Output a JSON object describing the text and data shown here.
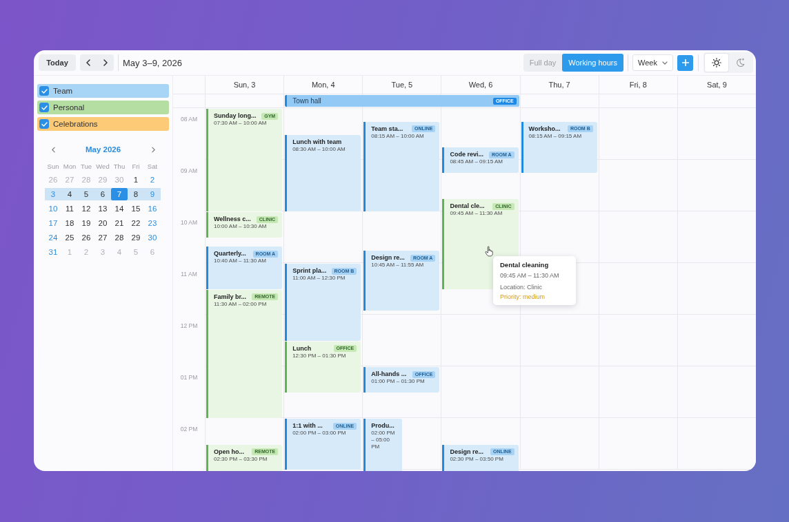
{
  "toolbar": {
    "today_button": "Today",
    "date_range": "May 3–9, 2026",
    "range_options": [
      {
        "label": "Full day",
        "selected": false
      },
      {
        "label": "Working hours",
        "selected": true
      }
    ],
    "view_select": {
      "value": "Week"
    },
    "theme_options": [
      {
        "kind": "light",
        "selected": true
      },
      {
        "kind": "dark",
        "selected": false
      }
    ]
  },
  "sidebar": {
    "categories": [
      {
        "label": "Team",
        "checked": true,
        "color": "#a8d5f6"
      },
      {
        "label": "Personal",
        "checked": true,
        "color": "#b4dea2"
      },
      {
        "label": "Celebrations",
        "checked": true,
        "color": "#fdcb78"
      }
    ],
    "mini_calendar": {
      "title": "May 2026",
      "weekdays": [
        "Sun",
        "Mon",
        "Tue",
        "Wed",
        "Thu",
        "Fri",
        "Sat"
      ],
      "weeks": [
        {
          "selected": false,
          "days": [
            {
              "label": "26",
              "outside": true,
              "selected": false
            },
            {
              "label": "27",
              "outside": true,
              "selected": false
            },
            {
              "label": "28",
              "outside": true,
              "selected": false
            },
            {
              "label": "29",
              "outside": true,
              "selected": false
            },
            {
              "label": "30",
              "outside": true,
              "selected": false
            },
            {
              "label": "1",
              "outside": false,
              "selected": false
            },
            {
              "label": "2",
              "outside": false,
              "selected": false
            }
          ]
        },
        {
          "selected": true,
          "days": [
            {
              "label": "3",
              "outside": false,
              "selected": false
            },
            {
              "label": "4",
              "outside": false,
              "selected": false
            },
            {
              "label": "5",
              "outside": false,
              "selected": false
            },
            {
              "label": "6",
              "outside": false,
              "selected": false
            },
            {
              "label": "7",
              "outside": false,
              "selected": true
            },
            {
              "label": "8",
              "outside": false,
              "selected": false
            },
            {
              "label": "9",
              "outside": false,
              "selected": false
            }
          ]
        },
        {
          "selected": false,
          "days": [
            {
              "label": "10",
              "outside": false,
              "selected": false
            },
            {
              "label": "11",
              "outside": false,
              "selected": false
            },
            {
              "label": "12",
              "outside": false,
              "selected": false
            },
            {
              "label": "13",
              "outside": false,
              "selected": false
            },
            {
              "label": "14",
              "outside": false,
              "selected": false
            },
            {
              "label": "15",
              "outside": false,
              "selected": false
            },
            {
              "label": "16",
              "outside": false,
              "selected": false
            }
          ]
        },
        {
          "selected": false,
          "days": [
            {
              "label": "17",
              "outside": false,
              "selected": false
            },
            {
              "label": "18",
              "outside": false,
              "selected": false
            },
            {
              "label": "19",
              "outside": false,
              "selected": false
            },
            {
              "label": "20",
              "outside": false,
              "selected": false
            },
            {
              "label": "21",
              "outside": false,
              "selected": false
            },
            {
              "label": "22",
              "outside": false,
              "selected": false
            },
            {
              "label": "23",
              "outside": false,
              "selected": false
            }
          ]
        },
        {
          "selected": false,
          "days": [
            {
              "label": "24",
              "outside": false,
              "selected": false
            },
            {
              "label": "25",
              "outside": false,
              "selected": false
            },
            {
              "label": "26",
              "outside": false,
              "selected": false
            },
            {
              "label": "27",
              "outside": false,
              "selected": false
            },
            {
              "label": "28",
              "outside": false,
              "selected": false
            },
            {
              "label": "29",
              "outside": false,
              "selected": false
            },
            {
              "label": "30",
              "outside": false,
              "selected": false
            }
          ]
        },
        {
          "selected": false,
          "days": [
            {
              "label": "31",
              "outside": false,
              "selected": false
            },
            {
              "label": "1",
              "outside": true,
              "selected": false
            },
            {
              "label": "2",
              "outside": true,
              "selected": false
            },
            {
              "label": "3",
              "outside": true,
              "selected": false
            },
            {
              "label": "4",
              "outside": true,
              "selected": false
            },
            {
              "label": "5",
              "outside": true,
              "selected": false
            },
            {
              "label": "6",
              "outside": true,
              "selected": false
            }
          ]
        }
      ]
    }
  },
  "calendar": {
    "all_day_events": [
      {
        "title": "Town hall",
        "badge": "OFFICE",
        "kind": "team"
      }
    ],
    "time_labels": [
      "08 AM",
      "09 AM",
      "10 AM",
      "11 AM",
      "12 PM",
      "01 PM",
      "02 PM"
    ],
    "days": [
      {
        "header": "Sun, 3",
        "events": [
          {
            "title": "Sunday long...",
            "badge": "GYM",
            "time": "07:30 AM – 10:00 AM",
            "kind": "personal",
            "overlapped": false
          },
          {
            "title": "Wellness c...",
            "badge": "CLINIC",
            "time": "10:00 AM – 10:30 AM",
            "kind": "personal",
            "overlapped": false
          },
          {
            "title": "Quarterly...",
            "badge": "ROOM A",
            "time": "10:40 AM – 11:30 AM",
            "kind": "team",
            "overlapped": false
          },
          {
            "title": "Family br...",
            "badge": "REMOTE",
            "time": "11:30 AM – 02:00 PM",
            "kind": "personal",
            "overlapped": false
          },
          {
            "title": "Open ho...",
            "badge": "REMOTE",
            "time": "02:30 PM – 03:30 PM",
            "kind": "personal",
            "overlapped": false
          }
        ]
      },
      {
        "header": "Mon, 4",
        "events": [
          {
            "title": "Lunch with team",
            "time": "08:30 AM – 10:00 AM",
            "kind": "team",
            "overlapped": false
          },
          {
            "title": "Sprint pla...",
            "badge": "ROOM B",
            "time": "11:00 AM – 12:30 PM",
            "kind": "team",
            "overlapped": false
          },
          {
            "title": "Lunch",
            "badge": "OFFICE",
            "time": "12:30 PM – 01:30 PM",
            "kind": "personal",
            "overlapped": false
          },
          {
            "title": "1:1 with ...",
            "badge": "ONLINE",
            "time": "02:00 PM – 03:00 PM",
            "kind": "team",
            "overlapped": false
          }
        ]
      },
      {
        "header": "Tue, 5",
        "events": [
          {
            "title": "Team sta...",
            "badge": "ONLINE",
            "time": "08:15 AM – 10:00 AM",
            "kind": "team",
            "overlapped": false
          },
          {
            "title": "Design re...",
            "badge": "ROOM A",
            "time": "10:45 AM – 11:55 AM",
            "kind": "team",
            "overlapped": false
          },
          {
            "title": "All-hands ...",
            "badge": "OFFICE",
            "time": "01:00 PM – 01:30 PM",
            "kind": "team",
            "overlapped": false
          },
          {
            "title": "Produ...",
            "time": "02:00 PM – 05:00 PM",
            "kind": "team",
            "overlapped": true
          }
        ]
      },
      {
        "header": "Wed, 6",
        "events": [
          {
            "title": "Code revi...",
            "badge": "ROOM A",
            "time": "08:45 AM – 09:15 AM",
            "kind": "team",
            "overlapped": false
          },
          {
            "title": "Dental cle...",
            "badge": "CLINIC",
            "time": "09:45 AM – 11:30 AM",
            "kind": "personal",
            "overlapped": false
          },
          {
            "title": "Design re...",
            "badge": "ONLINE",
            "time": "02:30 PM – 03:50 PM",
            "kind": "team",
            "overlapped": false
          }
        ]
      },
      {
        "header": "Thu, 7",
        "events": [
          {
            "title": "Worksho...",
            "badge": "ROOM B",
            "time": "08:15 AM – 09:15 AM",
            "kind": "team",
            "overlapped": false
          }
        ]
      },
      {
        "header": "Fri, 8"
      },
      {
        "header": "Sat, 9"
      }
    ],
    "tooltip": {
      "title": "Dental cleaning",
      "time": "09:45 AM – 11:30 AM",
      "location": "Location: Clinic",
      "priority": "Priority: medium"
    }
  }
}
